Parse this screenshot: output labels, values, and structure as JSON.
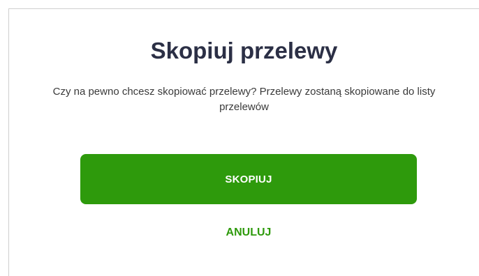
{
  "dialog": {
    "title": "Skopiuj przelewy",
    "message": "Czy na pewno chcesz skopiować przelewy? Przelewy zostaną skopiowane do listy przelewów",
    "confirm_label": "SKOPIUJ",
    "cancel_label": "ANULUJ"
  },
  "colors": {
    "accent": "#2e9a0c",
    "title_text": "#2b2f45"
  }
}
